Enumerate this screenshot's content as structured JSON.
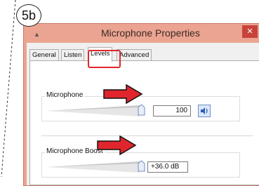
{
  "step_badge": "5b",
  "window": {
    "title": "Microphone Properties",
    "close_label": "✕"
  },
  "tabs": [
    {
      "label": "General",
      "active": false
    },
    {
      "label": "Listen",
      "active": false
    },
    {
      "label": "Levels",
      "active": true
    },
    {
      "label": "Advanced",
      "active": false
    }
  ],
  "microphone": {
    "label": "Microphone",
    "value": "100",
    "level_percent": 100
  },
  "microphone_boost": {
    "label": "Microphone Boost",
    "value": "+36.0 dB"
  },
  "colors": {
    "titlebar": "#eba491",
    "highlight": "#e0262c",
    "arrow": "#e0262c"
  }
}
